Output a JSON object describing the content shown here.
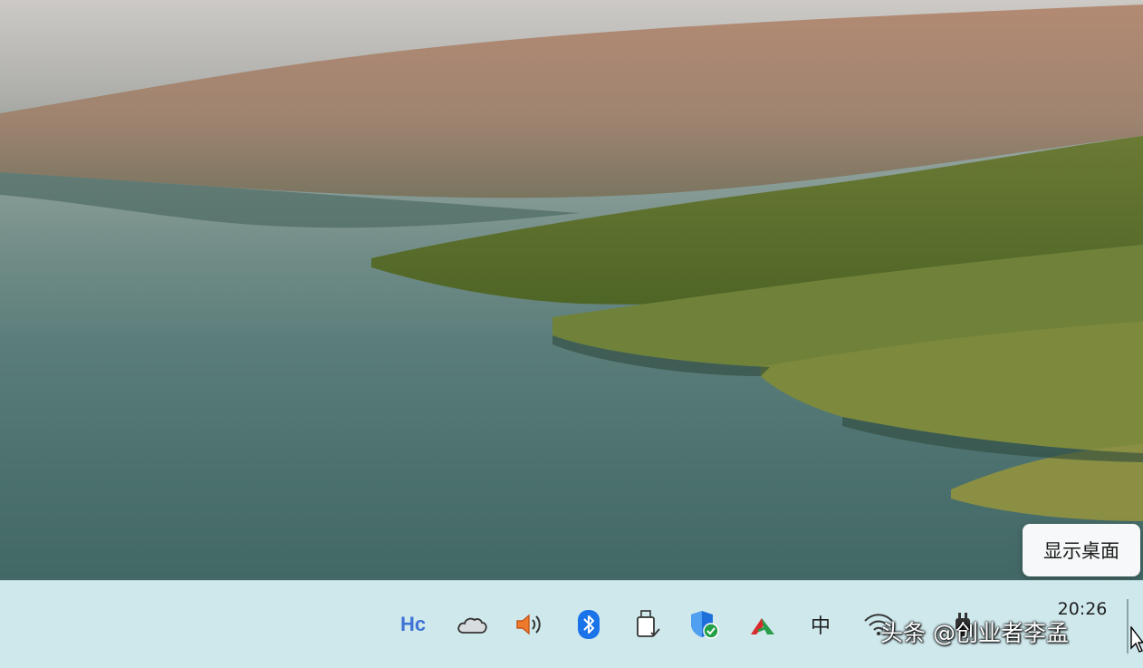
{
  "tooltip": {
    "text": "显示桌面"
  },
  "tray": {
    "hc_label": "Hc",
    "ime_label": "中"
  },
  "clock": {
    "time": "20:26"
  },
  "watermark": {
    "text": "头条 @创业者李孟"
  },
  "icons": [
    "hc-app-icon",
    "onedrive-cloud-icon",
    "volume-icon",
    "bluetooth-icon",
    "usb-drive-icon",
    "security-shield-icon",
    "app-tray-icon",
    "ime-icon",
    "wifi-icon",
    "power-plug-icon"
  ],
  "colors": {
    "taskbar": "#cfe8ec",
    "bluetooth": "#1a73e8",
    "shield": "#1e6fd9",
    "shield_check": "#23a047"
  }
}
